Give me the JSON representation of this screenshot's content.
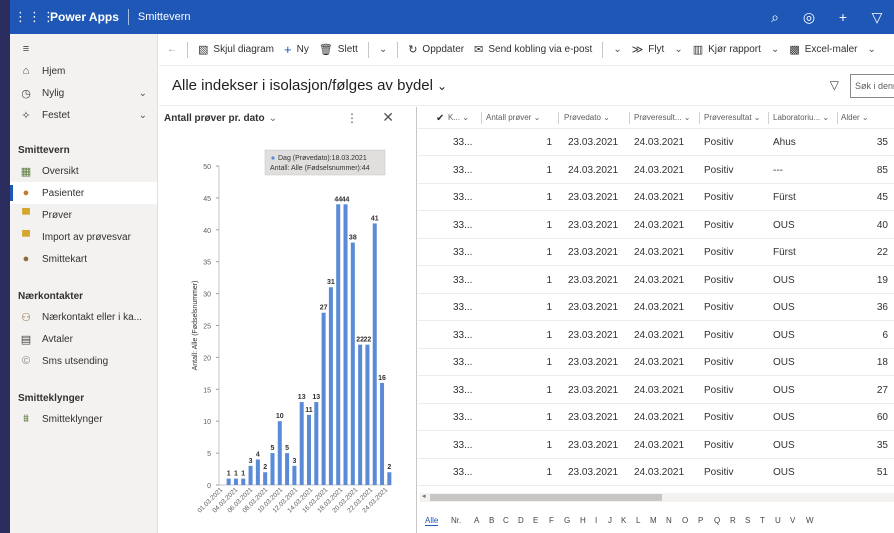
{
  "topbar": {
    "waffle": "⋮⋮⋮",
    "brand": "Power Apps",
    "app_name": "Smittevern",
    "icons": [
      "search-icon",
      "settings-icon",
      "add-icon",
      "filter-icon"
    ]
  },
  "sidebar": {
    "collapse": "≡",
    "top_items": [
      {
        "label": "Hjem",
        "icon": "home-icon"
      },
      {
        "label": "Nylig",
        "icon": "clock-icon",
        "expandable": true
      },
      {
        "label": "Festet",
        "icon": "pin-icon",
        "expandable": true
      }
    ],
    "section_smittevern": "Smittevern",
    "smittevern_items": [
      {
        "label": "Oversikt",
        "icon": "dashboard-icon"
      },
      {
        "label": "Pasienter",
        "icon": "patient-icon",
        "active": true
      },
      {
        "label": "Prøver",
        "icon": "sample-icon"
      },
      {
        "label": "Import av prøvesvar",
        "icon": "import-icon"
      },
      {
        "label": "Smittekart",
        "icon": "map-icon"
      }
    ],
    "section_naerkontakter": "Nærkontakter",
    "naerkontakter_items": [
      {
        "label": "Nærkontakt eller i ka...",
        "icon": "contact-icon"
      },
      {
        "label": "Avtaler",
        "icon": "calendar-icon"
      },
      {
        "label": "Sms utsending",
        "icon": "sms-icon"
      }
    ],
    "section_smitteklynger": "Smitteklynger",
    "smitteklynger_items": [
      {
        "label": "Smitteklynger",
        "icon": "cluster-icon"
      }
    ]
  },
  "commandbar": {
    "back": "←",
    "skjul_diagram": "Skjul diagram",
    "ny": "Ny",
    "slett": "Slett",
    "oppdater": "Oppdater",
    "send_kobling": "Send kobling via e-post",
    "flyt": "Flyt",
    "kjor_rapport": "Kjør rapport",
    "excel_maler": "Excel-maler"
  },
  "view": {
    "title": "Alle indekser i isolasjon/følges av bydel",
    "search_placeholder": "Søk i denne"
  },
  "chart_panel": {
    "title": "Antall prøver pr. dato",
    "more": "⋮",
    "close": "✕",
    "tooltip_line1": "Dag (Prøvedato):18.03.2021",
    "tooltip_line2": "Antall: Alle (Fødselsnummer):44"
  },
  "chart_data": {
    "type": "bar",
    "title": "Antall prøver pr. dato",
    "ylabel": "Antall: Alle (Fødselsnummer)",
    "xlabel": "",
    "ylim": [
      0,
      50
    ],
    "yticks": [
      0,
      5,
      10,
      15,
      20,
      25,
      30,
      35,
      40,
      45,
      50
    ],
    "x_tick_labels": [
      "01.03.2021",
      "04.03.2021",
      "06.03.2021",
      "08.03.2021",
      "10.03.2021",
      "12.03.2021",
      "14.03.2021",
      "16.03.2021",
      "18.03.2021",
      "20.03.2021",
      "22.03.2021",
      "24.03.2021"
    ],
    "values": [
      1,
      1,
      1,
      3,
      4,
      2,
      5,
      10,
      5,
      3,
      13,
      11,
      13,
      27,
      31,
      44,
      44,
      38,
      22,
      22,
      41,
      16,
      2
    ],
    "bar_color": "#5b8bd6",
    "grid": false
  },
  "grid": {
    "columns": [
      "K...",
      "Antall prøver",
      "Prøvedato",
      "Prøveresult...",
      "Prøveresultat",
      "Laboratoriu...",
      "Alder"
    ],
    "rows": [
      [
        "33...",
        "1",
        "23.03.2021",
        "24.03.2021",
        "Positiv",
        "Ahus",
        "35"
      ],
      [
        "33...",
        "1",
        "24.03.2021",
        "24.03.2021",
        "Positiv",
        "---",
        "85"
      ],
      [
        "33...",
        "1",
        "23.03.2021",
        "24.03.2021",
        "Positiv",
        "Fürst",
        "45"
      ],
      [
        "33...",
        "1",
        "23.03.2021",
        "24.03.2021",
        "Positiv",
        "OUS",
        "40"
      ],
      [
        "33...",
        "1",
        "23.03.2021",
        "24.03.2021",
        "Positiv",
        "Fürst",
        "22"
      ],
      [
        "33...",
        "1",
        "23.03.2021",
        "24.03.2021",
        "Positiv",
        "OUS",
        "19"
      ],
      [
        "33...",
        "1",
        "23.03.2021",
        "24.03.2021",
        "Positiv",
        "OUS",
        "36"
      ],
      [
        "33...",
        "1",
        "23.03.2021",
        "24.03.2021",
        "Positiv",
        "OUS",
        "6"
      ],
      [
        "33...",
        "1",
        "23.03.2021",
        "24.03.2021",
        "Positiv",
        "OUS",
        "18"
      ],
      [
        "33...",
        "1",
        "23.03.2021",
        "24.03.2021",
        "Positiv",
        "OUS",
        "27"
      ],
      [
        "33...",
        "1",
        "23.03.2021",
        "24.03.2021",
        "Positiv",
        "OUS",
        "60"
      ],
      [
        "33...",
        "1",
        "23.03.2021",
        "24.03.2021",
        "Positiv",
        "OUS",
        "35"
      ],
      [
        "33...",
        "1",
        "23.03.2021",
        "24.03.2021",
        "Positiv",
        "OUS",
        "51"
      ]
    ],
    "jump_letters": [
      "Alle",
      "Nr.",
      "A",
      "B",
      "C",
      "D",
      "E",
      "F",
      "G",
      "H",
      "I",
      "J",
      "K",
      "L",
      "M",
      "N",
      "O",
      "P",
      "Q",
      "R",
      "S",
      "T",
      "U",
      "V",
      "W"
    ]
  }
}
